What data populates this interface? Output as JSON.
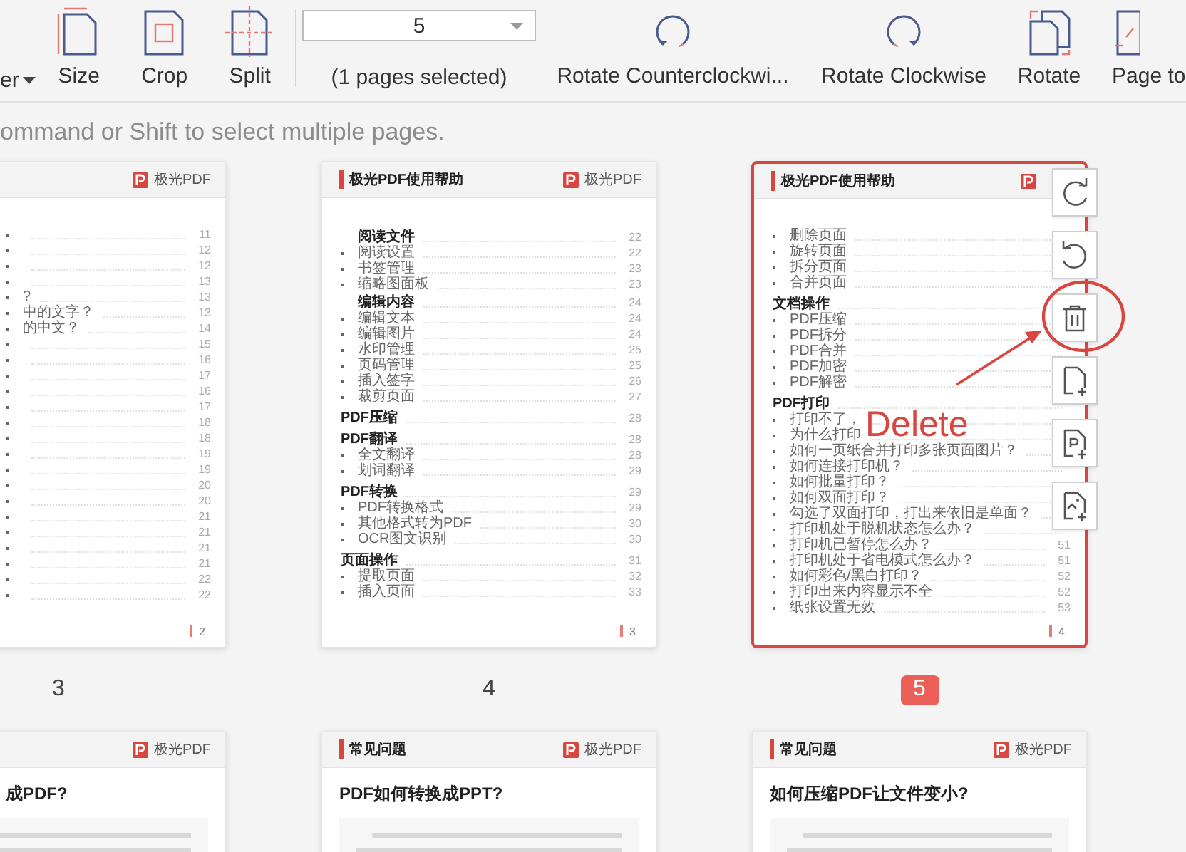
{
  "toolbar": {
    "items": [
      {
        "kind": "menu",
        "label": "er"
      },
      {
        "kind": "size",
        "label": "Size"
      },
      {
        "kind": "crop",
        "label": "Crop"
      },
      {
        "kind": "split",
        "label": "Split"
      },
      {
        "kind": "pages",
        "value": "5",
        "label": "(1 pages selected)"
      },
      {
        "kind": "counterclockwise",
        "label": "Rotate Counterclockwi..."
      },
      {
        "kind": "clockwise",
        "label": "Rotate Clockwise"
      },
      {
        "kind": "rotate",
        "label": "Rotate"
      },
      {
        "kind": "pageto",
        "label": "Page to"
      }
    ]
  },
  "hint": "ommand or Shift to select multiple pages.",
  "pages": [
    {
      "number": "3",
      "selected": false,
      "cut": true,
      "logo": "极光PDF",
      "footer": "2",
      "rows": [
        {
          "kind": "item",
          "page": "11"
        },
        {
          "kind": "item",
          "page": "12"
        },
        {
          "kind": "item",
          "page": "12"
        },
        {
          "kind": "item",
          "page": "13"
        },
        {
          "kind": "item",
          "text": "?",
          "page": "13"
        },
        {
          "kind": "item",
          "text": "中的文字？",
          "page": "13"
        },
        {
          "kind": "item",
          "text": "的中文？",
          "page": "14"
        },
        {
          "kind": "item",
          "page": "15"
        },
        {
          "kind": "item",
          "page": "16"
        },
        {
          "kind": "item",
          "page": "17"
        },
        {
          "kind": "item",
          "page": "16"
        },
        {
          "kind": "item",
          "page": "17"
        },
        {
          "kind": "item",
          "page": "18"
        },
        {
          "kind": "item",
          "page": "18"
        },
        {
          "kind": "item",
          "page": "19"
        },
        {
          "kind": "item",
          "page": "19"
        },
        {
          "kind": "item",
          "page": "20"
        },
        {
          "kind": "item",
          "page": "20"
        },
        {
          "kind": "item",
          "page": "21"
        },
        {
          "kind": "item",
          "page": "21"
        },
        {
          "kind": "item",
          "page": "21"
        },
        {
          "kind": "item",
          "page": "21"
        },
        {
          "kind": "item",
          "page": "22"
        },
        {
          "kind": "item",
          "page": "22"
        }
      ]
    },
    {
      "number": "4",
      "selected": false,
      "cut": false,
      "title": "极光PDF使用帮助",
      "logo": "极光PDF",
      "footer": "3",
      "rows": [
        {
          "kind": "heading",
          "text": "阅读文件",
          "page": "22"
        },
        {
          "kind": "item",
          "text": "阅读设置",
          "page": "22"
        },
        {
          "kind": "item",
          "text": "书签管理",
          "page": "23"
        },
        {
          "kind": "item",
          "text": "缩略图面板",
          "page": "23"
        },
        {
          "kind": "heading",
          "text": "编辑内容",
          "page": "24"
        },
        {
          "kind": "item",
          "text": "编辑文本",
          "page": "24"
        },
        {
          "kind": "item",
          "text": "编辑图片",
          "page": "24"
        },
        {
          "kind": "item",
          "text": "水印管理",
          "page": "25"
        },
        {
          "kind": "item",
          "text": "页码管理",
          "page": "25"
        },
        {
          "kind": "item",
          "text": "插入签字",
          "page": "26"
        },
        {
          "kind": "item",
          "text": "裁剪页面",
          "page": "27"
        },
        {
          "kind": "section",
          "text": "PDF压缩",
          "page": "28"
        },
        {
          "kind": "section",
          "text": "PDF翻译",
          "page": "28"
        },
        {
          "kind": "item",
          "text": "全文翻译",
          "page": "28"
        },
        {
          "kind": "item",
          "text": "划词翻译",
          "page": "29"
        },
        {
          "kind": "section",
          "text": "PDF转换",
          "page": "29"
        },
        {
          "kind": "item",
          "text": "PDF转换格式",
          "page": "29"
        },
        {
          "kind": "item",
          "text": "其他格式转为PDF",
          "page": "30"
        },
        {
          "kind": "item",
          "text": "OCR图文识别",
          "page": "30"
        },
        {
          "kind": "section",
          "text": "页面操作",
          "page": "31"
        },
        {
          "kind": "item",
          "text": "提取页面",
          "page": "32"
        },
        {
          "kind": "item",
          "text": "插入页面",
          "page": "33"
        }
      ]
    },
    {
      "number": "5",
      "selected": true,
      "cut": false,
      "title": "极光PDF使用帮助",
      "footer": "4",
      "rows": [
        {
          "kind": "item",
          "text": "删除页面"
        },
        {
          "kind": "item",
          "text": "旋转页面"
        },
        {
          "kind": "item",
          "text": "拆分页面"
        },
        {
          "kind": "item",
          "text": "合并页面"
        },
        {
          "kind": "section",
          "text": "文档操作"
        },
        {
          "kind": "item",
          "text": "PDF压缩"
        },
        {
          "kind": "item",
          "text": "PDF拆分"
        },
        {
          "kind": "item",
          "text": "PDF合并"
        },
        {
          "kind": "item",
          "text": "PDF加密"
        },
        {
          "kind": "item",
          "text": "PDF解密"
        },
        {
          "kind": "section",
          "text": "PDF打印"
        },
        {
          "kind": "item",
          "text": "打印不了，"
        },
        {
          "kind": "item",
          "text": "为什么打印"
        },
        {
          "kind": "item",
          "text": "如何一页纸合并打印多张页面图片？"
        },
        {
          "kind": "item",
          "text": "如何连接打印机？"
        },
        {
          "kind": "item",
          "text": "如何批量打印？"
        },
        {
          "kind": "item",
          "text": "如何双面打印？"
        },
        {
          "kind": "item",
          "text": "勾选了双面打印，打出来依旧是单面？"
        },
        {
          "kind": "item",
          "text": "打印机处于脱机状态怎么办？"
        },
        {
          "kind": "item",
          "text": "打印机已暂停怎么办？",
          "page": "51"
        },
        {
          "kind": "item",
          "text": "打印机处于省电模式怎么办？",
          "page": "51"
        },
        {
          "kind": "item",
          "text": "如何彩色/黑白打印？",
          "page": "52"
        },
        {
          "kind": "item",
          "text": "打印出来内容显示不全",
          "page": "52"
        },
        {
          "kind": "item",
          "text": "纸张设置无效",
          "page": "53"
        }
      ]
    }
  ],
  "page_actions": [
    {
      "kind": "clockwise"
    },
    {
      "kind": "counterclockwise"
    },
    {
      "kind": "delete"
    },
    {
      "kind": "blank"
    },
    {
      "kind": "pdf"
    },
    {
      "kind": "image"
    }
  ],
  "annotation": {
    "label": "Delete"
  },
  "next_pages": [
    {
      "cut": true,
      "logo": "极光PDF",
      "title": "成PDF?"
    },
    {
      "cut": false,
      "header": "常见问题",
      "logo": "极光PDF",
      "title": "PDF如何转换成PPT?"
    },
    {
      "cut": false,
      "header": "常见问题",
      "logo": "极光PDF",
      "title": "如何压缩PDF让文件变小?"
    }
  ]
}
